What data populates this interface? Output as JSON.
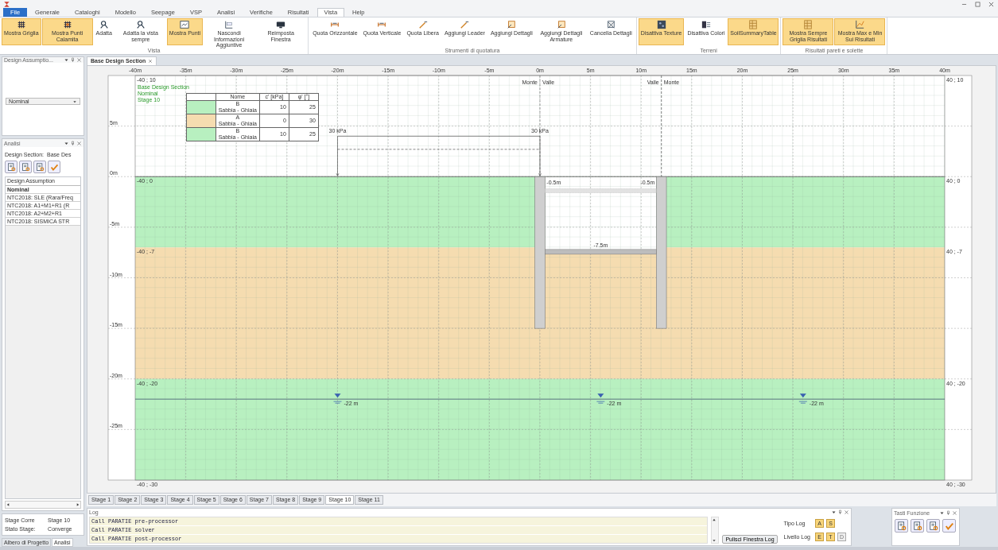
{
  "ribbon": {
    "tabs": [
      {
        "label": "File",
        "kind": "file",
        "selected": false
      },
      {
        "label": "Generale",
        "kind": "tab",
        "selected": false
      },
      {
        "label": "Cataloghi",
        "kind": "tab",
        "selected": false
      },
      {
        "label": "Modello",
        "kind": "tab",
        "selected": false
      },
      {
        "label": "Seepage",
        "kind": "tab",
        "selected": false
      },
      {
        "label": "VSP",
        "kind": "tab",
        "selected": false
      },
      {
        "label": "Analisi",
        "kind": "tab",
        "selected": false
      },
      {
        "label": "Verifiche",
        "kind": "tab",
        "selected": false
      },
      {
        "label": "Risultati",
        "kind": "tab",
        "selected": false
      },
      {
        "label": "Vista",
        "kind": "tab",
        "selected": true
      },
      {
        "label": "Help",
        "kind": "tab",
        "selected": false
      }
    ],
    "groups": [
      {
        "label": "Vista",
        "buttons": [
          {
            "label": "Mostra Griglia",
            "on": true
          },
          {
            "label": "Mostra Punti Calamita",
            "on": true
          },
          {
            "label": "Adatta",
            "on": false
          },
          {
            "label": "Adatta la vista sempre",
            "on": false
          },
          {
            "label": "Mostra Punti",
            "on": true
          },
          {
            "label": "Nascondi Informazioni Aggiuntive",
            "on": false
          },
          {
            "label": "Reimposta Finestra",
            "on": false
          }
        ]
      },
      {
        "label": "Strumenti di quotatura",
        "buttons": [
          {
            "label": "Quota Orizzontale",
            "on": false
          },
          {
            "label": "Quota Verticale",
            "on": false
          },
          {
            "label": "Quota Libera",
            "on": false
          },
          {
            "label": "Aggiungi Leader",
            "on": false
          },
          {
            "label": "Aggiungi Dettagli",
            "on": false
          },
          {
            "label": "Aggiungi Dettagli Armature",
            "on": false
          },
          {
            "label": "Cancella Dettagli",
            "on": false
          }
        ]
      },
      {
        "label": "Terreni",
        "buttons": [
          {
            "label": "Disattiva Texture",
            "on": true
          },
          {
            "label": "Disattiva Colori",
            "on": false
          },
          {
            "label": "SoilSummaryTable",
            "on": true
          }
        ]
      },
      {
        "label": "Risultati pareti e solette",
        "buttons": [
          {
            "label": "Mostra Sempre Griglia Risultati",
            "on": true
          },
          {
            "label": "Mostra Max e Min Sui Risultati",
            "on": true
          }
        ]
      }
    ]
  },
  "left_panel": {
    "design_assumptions": {
      "title": "Design Assumptio...",
      "dropdown": "Nominal"
    },
    "analisi": {
      "title": "Analisi",
      "design_section_label": "Design Section:",
      "design_section_value": "Base Des",
      "list_header": "Design Assumption",
      "items": [
        {
          "label": "Nominal",
          "selected": true
        },
        {
          "label": "NTC2018: SLE (Rara/Freq",
          "selected": false
        },
        {
          "label": "NTC2018: A1+M1+R1 (R",
          "selected": false
        },
        {
          "label": "NTC2018: A2+M2+R1",
          "selected": false
        },
        {
          "label": "NTC2018: SISMICA STR",
          "selected": false
        }
      ]
    },
    "stage_current_label": "Stage Corre",
    "stage_current": "Stage 10",
    "stage_state_label": "Stato Stage:",
    "stage_state": "Converge",
    "tabs": [
      {
        "label": "Albero di Progetto",
        "selected": false
      },
      {
        "label": "Analisi",
        "selected": true
      }
    ]
  },
  "document": {
    "tab": "Base Design Section",
    "x_axis": [
      "-40m",
      "-35m",
      "-30m",
      "-25m",
      "-20m",
      "-15m",
      "-10m",
      "-5m",
      "0m",
      "5m",
      "10m",
      "15m",
      "20m",
      "25m",
      "30m",
      "35m",
      "40m"
    ],
    "y_axis": [
      "5m",
      "0m",
      "-5m",
      "-10m",
      "-15m",
      "-20m",
      "-25m"
    ],
    "info": [
      "Base Design Section",
      "Nominal",
      "Stage 10"
    ],
    "legend": {
      "columns": [
        "Nome",
        "c' [kPa]",
        "φ' [°]"
      ],
      "rows": [
        {
          "code": "B",
          "name": "Sabbia - Ghiaia",
          "c": "10",
          "phi": "25",
          "color": "#b8f0c0"
        },
        {
          "code": "A",
          "name": "Sabbia - Ghiaia",
          "c": "0",
          "phi": "30",
          "color": "#f5dcb0"
        },
        {
          "code": "B",
          "name": "Sabbia - Ghiaia",
          "c": "10",
          "phi": "25",
          "color": "#b8f0c0"
        }
      ]
    },
    "layers": [
      {
        "color": "#b8f0c0"
      },
      {
        "color": "#f5dcb0"
      },
      {
        "color": "#b8f0c0"
      }
    ],
    "coordinate_labels": [
      {
        "left": "-40 ; 10",
        "right": "40 ; 10"
      },
      {
        "left": "-40 ; 0",
        "right": "40 ; 0"
      },
      {
        "left": "-40 ; -7",
        "right": "40 ; -7"
      },
      {
        "left": "-40 ; -20",
        "right": "40 ; -20"
      },
      {
        "left": "-40 ; -30",
        "right": "40 ; -30"
      }
    ],
    "loads": [
      "30 kPa",
      "30 kPa"
    ],
    "walls": [
      {
        "left": "Monte",
        "right": "Valle",
        "depth_label": "-0.5m"
      },
      {
        "left": "Valle",
        "right": "Monte",
        "depth_label": "-0.5m"
      }
    ],
    "strut_label": "-7.5m",
    "water_tables": [
      "-22 m",
      "-22 m",
      "-22 m"
    ],
    "stage_tabs": [
      {
        "label": "Stage 1",
        "selected": false
      },
      {
        "label": "Stage 2",
        "selected": false
      },
      {
        "label": "Stage 3",
        "selected": false
      },
      {
        "label": "Stage 4",
        "selected": false
      },
      {
        "label": "Stage 5",
        "selected": false
      },
      {
        "label": "Stage 6",
        "selected": false
      },
      {
        "label": "Stage 7",
        "selected": false
      },
      {
        "label": "Stage 8",
        "selected": false
      },
      {
        "label": "Stage 9",
        "selected": false
      },
      {
        "label": "Stage 10",
        "selected": true
      },
      {
        "label": "Stage 11",
        "selected": false
      }
    ]
  },
  "log": {
    "title": "Log",
    "lines": [
      "Call PARATIE pre-processor",
      "Call PARATIE solver",
      "Call PARATIE post-processor"
    ],
    "clear_button": "Pulisci Finestra Log",
    "type_label": "Tipo Log",
    "types": [
      {
        "label": "A",
        "on": true
      },
      {
        "label": "S",
        "on": true
      }
    ],
    "level_label": "Livello Log",
    "levels": [
      {
        "label": "E",
        "on": true
      },
      {
        "label": "T",
        "on": true
      },
      {
        "label": "D",
        "on": false
      }
    ]
  },
  "function_keys": {
    "title": "Tasti Funzione"
  }
}
